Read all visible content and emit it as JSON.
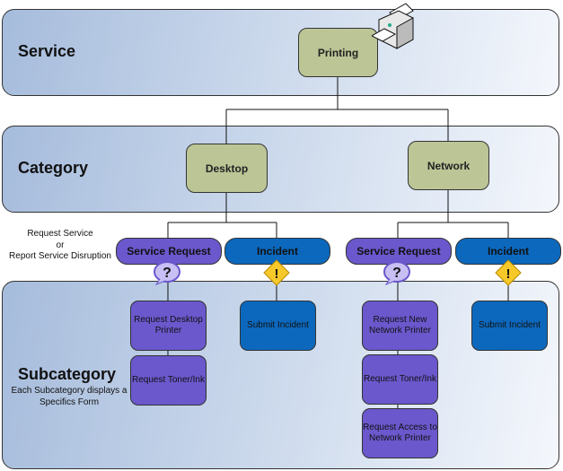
{
  "bands": {
    "service": "Service",
    "category": "Category",
    "subcategory": "Subcategory",
    "subcategory_note": "Each Subcategory displays a Specifics Form"
  },
  "side_note": {
    "line1": "Request Service",
    "line2": "or",
    "line3": "Report Service Disruption"
  },
  "service_node": "Printing",
  "categories": [
    {
      "label": "Desktop",
      "types": [
        {
          "label": "Service Request",
          "icon": "question-bubble-icon",
          "items": [
            "Request Desktop Printer",
            "Request Toner/Ink"
          ]
        },
        {
          "label": "Incident",
          "icon": "warning-icon",
          "items": [
            "Submit Incident"
          ]
        }
      ]
    },
    {
      "label": "Network",
      "types": [
        {
          "label": "Service Request",
          "icon": "question-bubble-icon",
          "items": [
            "Request New Network Printer",
            "Request Toner/Ink",
            "Request Access to Network Printer"
          ]
        },
        {
          "label": "Incident",
          "icon": "warning-icon",
          "items": [
            "Submit Incident"
          ]
        }
      ]
    }
  ],
  "colors": {
    "service_request": "#6a58cc",
    "incident": "#0c68bd",
    "top_nodes": "#bcc596"
  }
}
